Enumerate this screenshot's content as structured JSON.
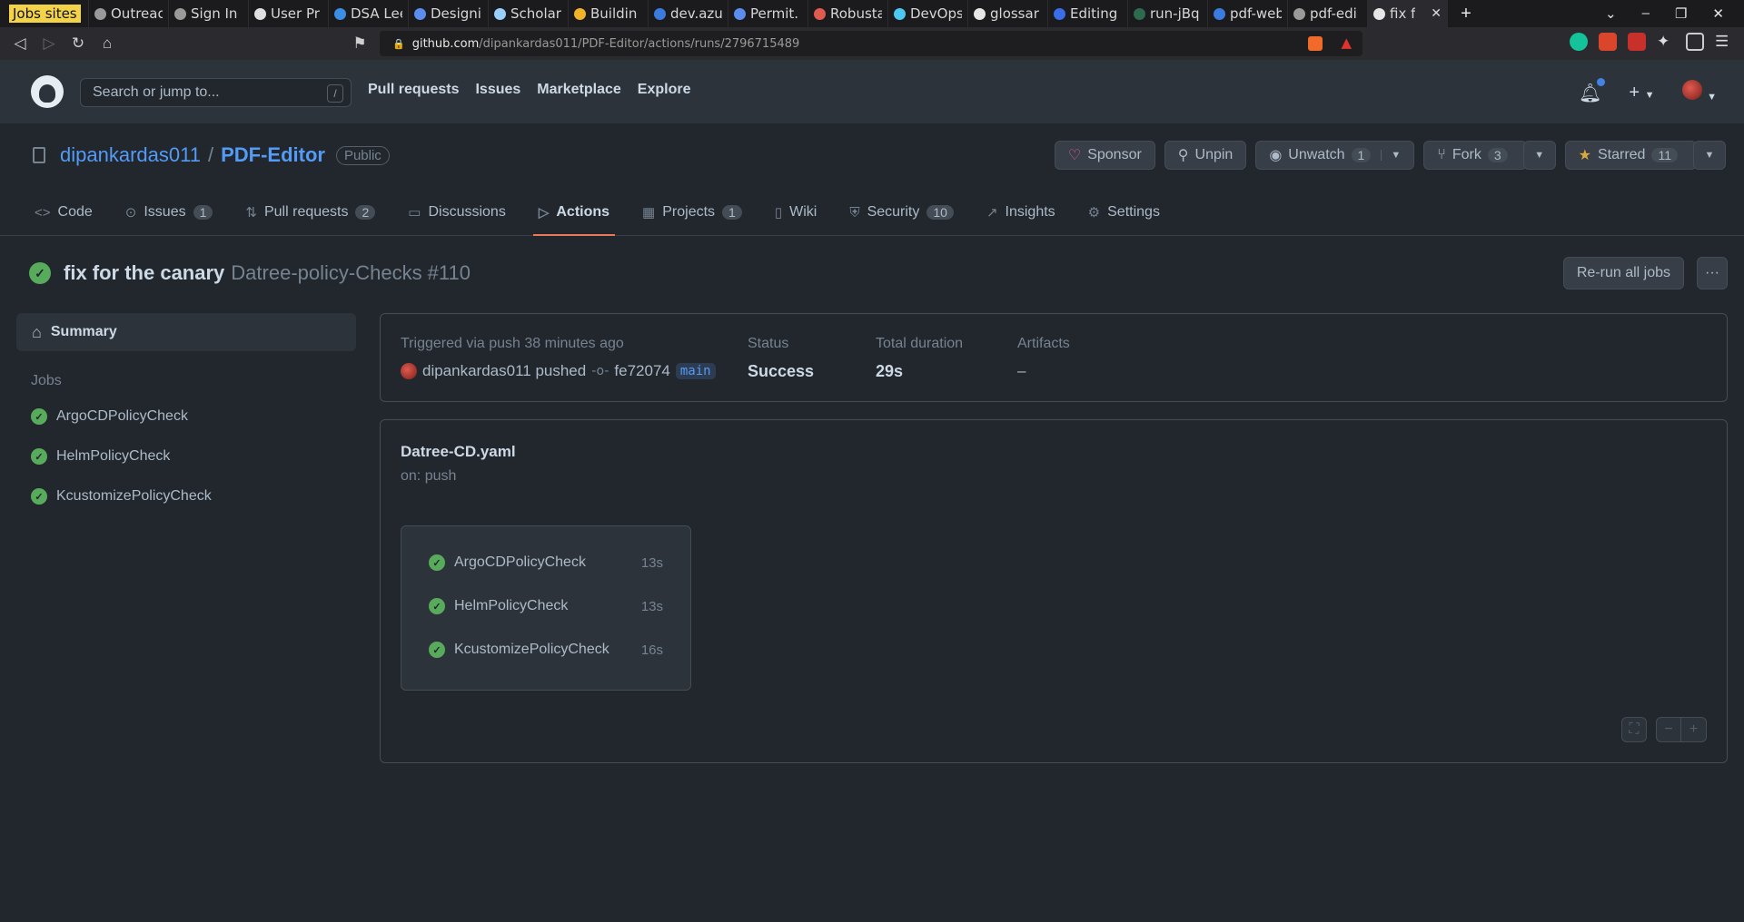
{
  "browser": {
    "tabs": [
      {
        "label": "Jobs sites",
        "color": "#f3d34a"
      },
      {
        "label": "Outreac",
        "color": "#9a9a9a"
      },
      {
        "label": "Sign In",
        "color": "#9a9a9a"
      },
      {
        "label": "User Pr",
        "color": "#e0e0e0"
      },
      {
        "label": "DSA Lee",
        "color": "#3a8ee6"
      },
      {
        "label": "Designi",
        "color": "#5b8def"
      },
      {
        "label": "Scholar",
        "color": "#9ad0ff"
      },
      {
        "label": "Buildin",
        "color": "#f0b429"
      },
      {
        "label": "dev.azu",
        "color": "#3b7be0"
      },
      {
        "label": "Permit.",
        "color": "#5b8def"
      },
      {
        "label": "Robusta",
        "color": "#e05a4f"
      },
      {
        "label": "DevOps",
        "color": "#4cc9f0"
      },
      {
        "label": "glossar",
        "color": "#e6e6e6"
      },
      {
        "label": "Editing",
        "color": "#3a6ee8"
      },
      {
        "label": "run-jBq",
        "color": "#2d6a4f"
      },
      {
        "label": "pdf-web",
        "color": "#3b7be0"
      },
      {
        "label": "pdf-edi",
        "color": "#9a9a9a"
      },
      {
        "label": "fix f",
        "color": "#e6e6e6"
      }
    ],
    "url_host": "github.com",
    "url_path": "/dipankardas011/PDF-Editor/actions/runs/2796715489"
  },
  "header": {
    "search_placeholder": "Search or jump to...",
    "search_shortcut": "/",
    "nav": [
      "Pull requests",
      "Issues",
      "Marketplace",
      "Explore"
    ]
  },
  "repo": {
    "owner": "dipankardas011",
    "separator": "/",
    "name": "PDF-Editor",
    "visibility": "Public",
    "sponsor_label": "Sponsor",
    "unpin_label": "Unpin",
    "unwatch_label": "Unwatch",
    "watch_count": "1",
    "fork_label": "Fork",
    "fork_count": "3",
    "starred_label": "Starred",
    "star_count": "11",
    "tabs": [
      {
        "label": "Code",
        "count": "",
        "icon": "<>"
      },
      {
        "label": "Issues",
        "count": "1",
        "icon": "⊙"
      },
      {
        "label": "Pull requests",
        "count": "2",
        "icon": "⇅"
      },
      {
        "label": "Discussions",
        "count": "",
        "icon": "▭"
      },
      {
        "label": "Actions",
        "count": "",
        "icon": "▷"
      },
      {
        "label": "Projects",
        "count": "1",
        "icon": "▦"
      },
      {
        "label": "Wiki",
        "count": "",
        "icon": "▯"
      },
      {
        "label": "Security",
        "count": "10",
        "icon": "⛨"
      },
      {
        "label": "Insights",
        "count": "",
        "icon": "↗"
      },
      {
        "label": "Settings",
        "count": "",
        "icon": "⚙"
      }
    ]
  },
  "run": {
    "title": "fix for the canary",
    "workflow_ref": "Datree-policy-Checks #110",
    "rerun_label": "Re-run all jobs",
    "more_label": "···"
  },
  "sidebar": {
    "summary_label": "Summary",
    "jobs_label": "Jobs",
    "jobs": [
      "ArgoCDPolicyCheck",
      "HelmPolicyCheck",
      "KcustomizePolicyCheck"
    ]
  },
  "summary": {
    "trigger": "Triggered via push 38 minutes ago",
    "actor": "dipankardas011 pushed",
    "commit": "fe72074",
    "branch": "main",
    "status_label": "Status",
    "status_value": "Success",
    "duration_label": "Total duration",
    "duration_value": "29s",
    "artifacts_label": "Artifacts",
    "artifacts_value": "–"
  },
  "workflow": {
    "file": "Datree-CD.yaml",
    "on": "on: push",
    "jobs": [
      {
        "name": "ArgoCDPolicyCheck",
        "duration": "13s"
      },
      {
        "name": "HelmPolicyCheck",
        "duration": "13s"
      },
      {
        "name": "KcustomizePolicyCheck",
        "duration": "16s"
      }
    ]
  },
  "colors": {
    "success": "#57ab5a",
    "accent": "#539bf5",
    "active_tab": "#ec775c"
  }
}
